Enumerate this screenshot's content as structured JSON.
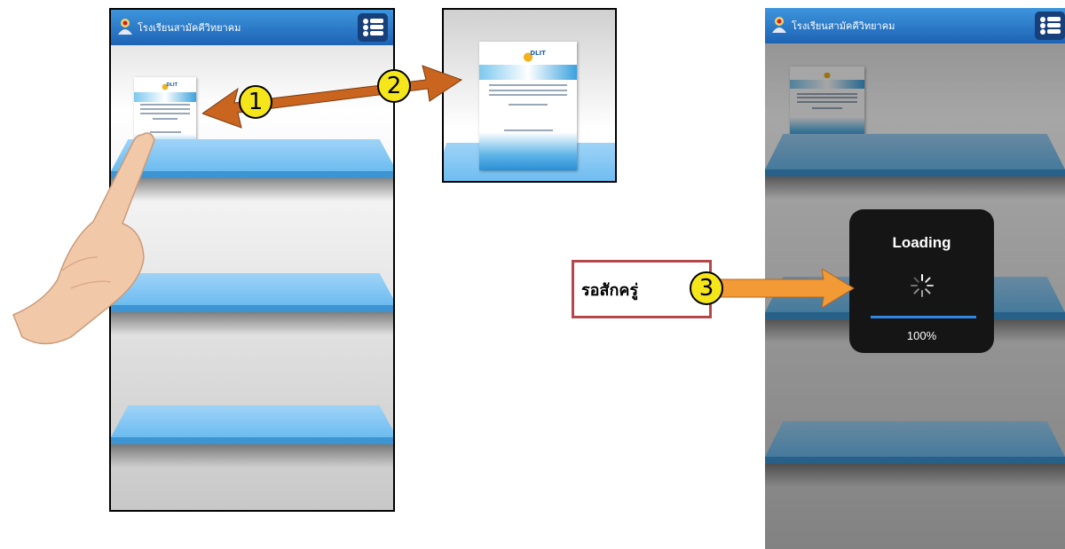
{
  "app": {
    "title": "โรงเรียนสามัคคีวิทยาคม",
    "menu_icon": "list-icon"
  },
  "book": {
    "cover_logo_text": "DLIT"
  },
  "steps": {
    "one": "1",
    "two": "2",
    "three": "3"
  },
  "wait_label": "รอสักครู่",
  "loading": {
    "title": "Loading",
    "percent_text": "100%",
    "progress": 1.0
  },
  "colors": {
    "header_blue": "#1d63b4",
    "shelf_blue": "#6cbcf0",
    "arrow_brown": "#c9651e",
    "arrow_orange": "#f29a36",
    "step_yellow": "#f5e61b",
    "label_border": "#b5474a"
  }
}
